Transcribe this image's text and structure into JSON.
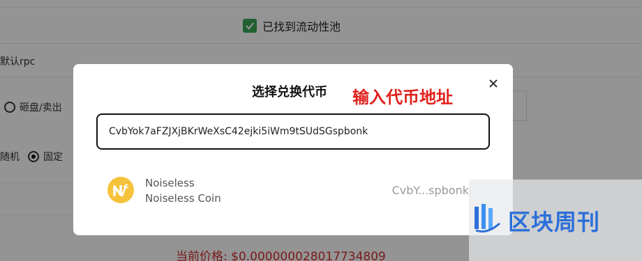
{
  "background": {
    "pool_found_label": "已找到流动性池",
    "rpc_label": "默认rpc",
    "sell_option": "砸盘/卖出",
    "random_label": "随机",
    "fixed_label": "固定",
    "price_label": "当前价格: $0.000000028017734809"
  },
  "modal": {
    "title": "选择兑换代币",
    "search_value": "CvbYok7aFZJXjBKrWeXsC42ejki5iWm9tSUdSGspbonk",
    "tokens": [
      {
        "symbol": "Noiseless",
        "name": "Noiseless Coin",
        "address_short": "CvbY...spbonk"
      }
    ]
  },
  "annotation": "输入代币地址",
  "watermark": {
    "text": "区块周刊"
  },
  "colors": {
    "accent_green": "#3aa655",
    "annotation_red": "#e0201b",
    "watermark_blue": "#2c6fd9",
    "token_yellow": "#f5c23b"
  }
}
